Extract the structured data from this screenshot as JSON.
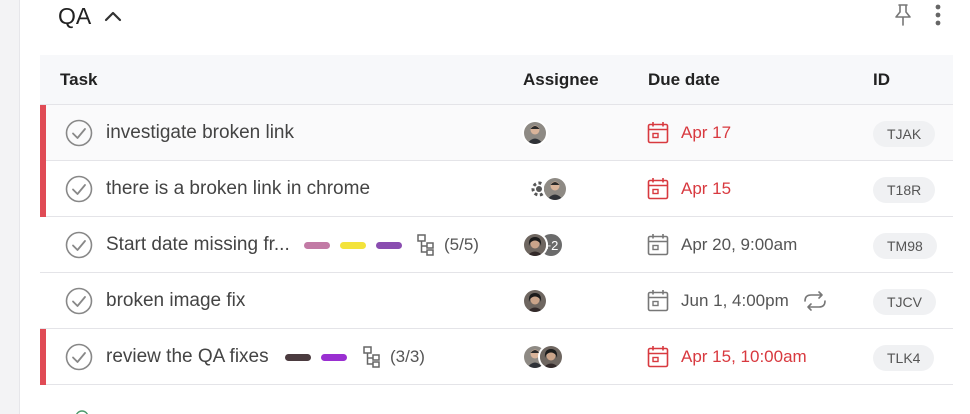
{
  "section": {
    "title": "QA"
  },
  "columns": {
    "task": "Task",
    "assignee": "Assignee",
    "due_date": "Due date",
    "id": "ID"
  },
  "colors": {
    "overdue": "#d8393f",
    "flag": "#e04b55",
    "tag_pink": "#c27aa5",
    "tag_yellow": "#f3e33b",
    "tag_purple": "#8a4db0",
    "tag_dark": "#4b3b3f",
    "tag_violet": "#9a2fd1"
  },
  "tasks": [
    {
      "name": "investigate broken link",
      "due": "Apr 17",
      "overdue": true,
      "id": "TJAK",
      "assignees": 1
    },
    {
      "name": "there is a broken link in chrome",
      "due": "Apr 15",
      "overdue": true,
      "id": "T18R",
      "assignees": 2
    },
    {
      "name": "Start date missing fr...",
      "subtasks": "(5/5)",
      "assignee_more": "+2",
      "due": "Apr 20, 9:00am",
      "overdue": false,
      "id": "TM98",
      "assignees": 1,
      "tags": [
        "pink",
        "yellow",
        "purple"
      ]
    },
    {
      "name": "broken image fix",
      "due": "Jun 1, 4:00pm",
      "recurring": true,
      "overdue": false,
      "id": "TJCV",
      "assignees": 1
    },
    {
      "name": "review the QA fixes",
      "subtasks": "(3/3)",
      "due": "Apr 15, 10:00am",
      "overdue": true,
      "id": "TLK4",
      "assignees": 2,
      "tags": [
        "dark",
        "violet"
      ]
    }
  ],
  "icons": {
    "collapse": "chevron-up-icon",
    "pin": "pin-icon",
    "more": "more-vertical-icon",
    "check": "check-circle-icon",
    "calendar": "calendar-icon",
    "subtask": "subtask-icon",
    "repeat": "repeat-icon"
  }
}
